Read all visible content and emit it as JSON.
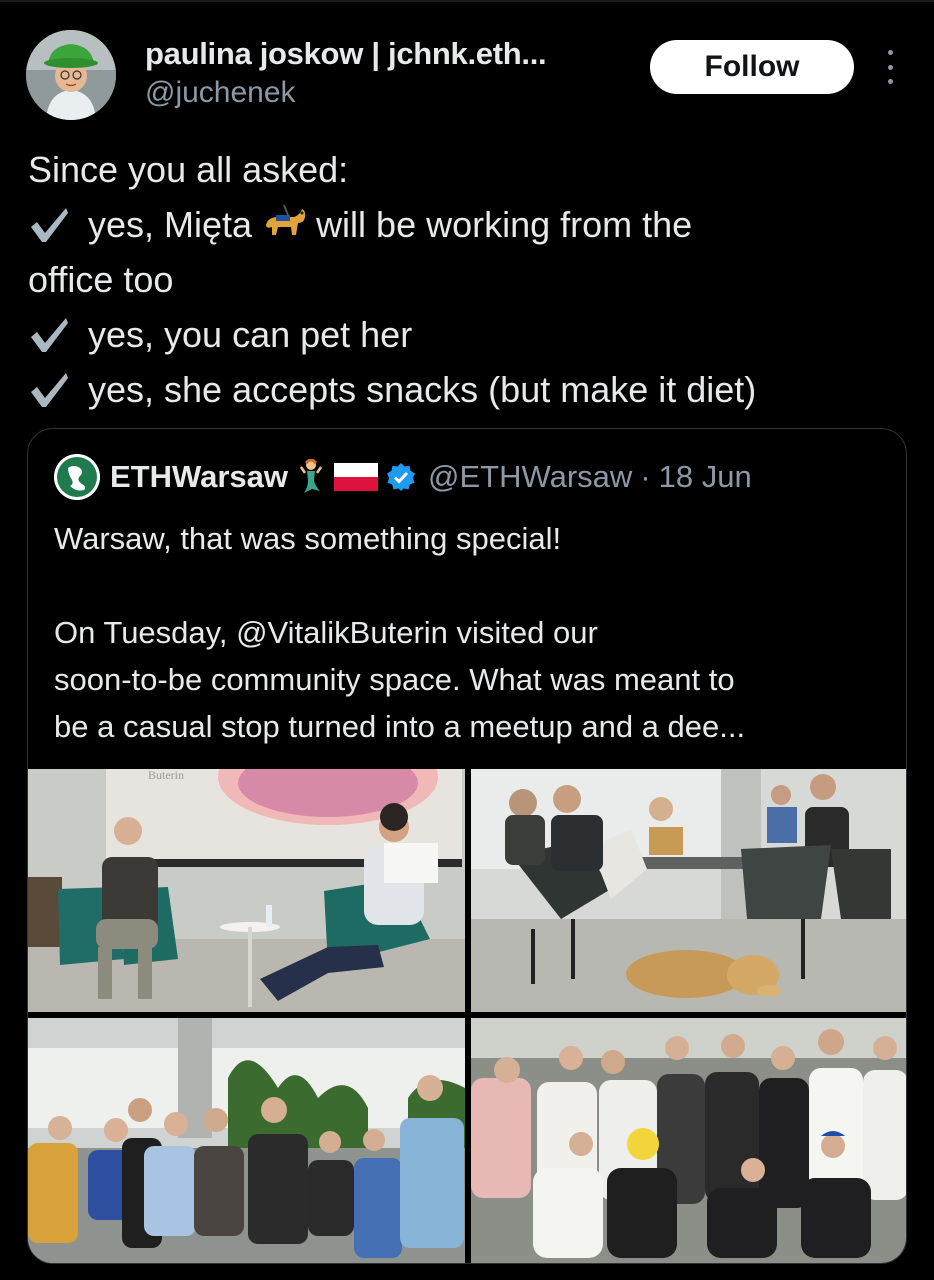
{
  "tweet": {
    "author_name": "paulina joskow | jchnk.eth...",
    "author_handle": "@juchenek",
    "follow_label": "Follow",
    "lines": {
      "l1": "Since you all asked:",
      "l2a": "yes, Mięta",
      "l2b": "will be working from the",
      "l3": "office too",
      "l4": "yes, you can pet her",
      "l5": "yes, she accepts snacks (but make it diet)"
    }
  },
  "quote": {
    "name": "ETHWarsaw",
    "handle": "@ETHWarsaw",
    "separator": "·",
    "date": "18 Jun",
    "lines": {
      "l1": "Warsaw, that was something special!",
      "l2": "",
      "l3": "On Tuesday, @VitalikButerin visited our",
      "l4": "soon-to-be community space. What was meant to",
      "l5": "be a casual stop turned into a meetup and a dee..."
    },
    "photos": {
      "screen_text": "Buterin"
    }
  },
  "colors": {
    "background": "#000000",
    "text": "#e7e9ea",
    "secondary_text": "#8b98a5",
    "border": "#2f3336",
    "verified": "#1d9bf0",
    "follow_bg": "#ffffff"
  },
  "icons": [
    "avatar",
    "more-dots-icon",
    "check-icon",
    "guide-dog-emoji",
    "ethwarsaw-logo",
    "mermaid-emoji",
    "poland-flag-emoji",
    "verified-badge-icon"
  ]
}
